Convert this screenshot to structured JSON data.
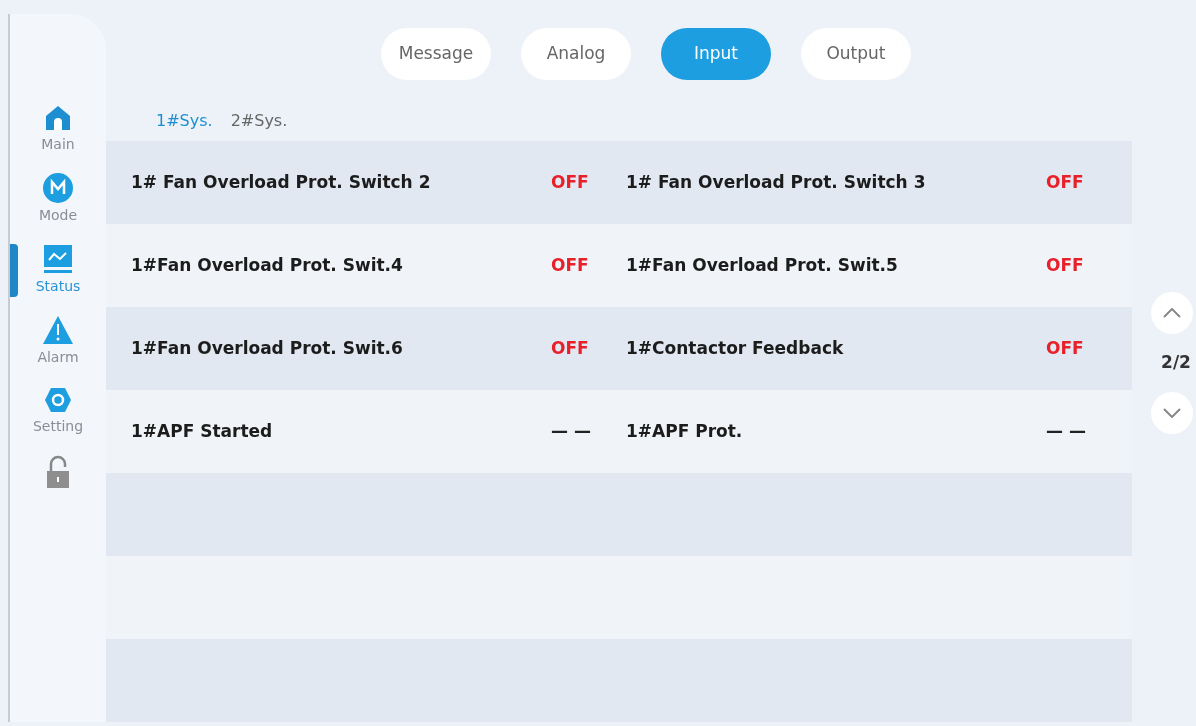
{
  "sidebar": {
    "items": [
      {
        "label": "Main",
        "selected": false
      },
      {
        "label": "Mode",
        "selected": false
      },
      {
        "label": "Status",
        "selected": true
      },
      {
        "label": "Alarm",
        "selected": false
      },
      {
        "label": "Setting",
        "selected": false
      },
      {
        "selected": false
      }
    ]
  },
  "tabs": [
    {
      "label": "Message",
      "selected": false
    },
    {
      "label": "Analog",
      "selected": false
    },
    {
      "label": "Input",
      "selected": true
    },
    {
      "label": "Output",
      "selected": false
    }
  ],
  "subtabs": [
    {
      "label": "1#Sys.",
      "selected": true
    },
    {
      "label": "2#Sys.",
      "selected": false
    }
  ],
  "rows": [
    [
      {
        "name": "1# Fan Overload Prot. Switch 2",
        "value": "OFF",
        "color": "#e8202a"
      },
      {
        "name": "1# Fan Overload Prot. Switch 3",
        "value": "OFF",
        "color": "#e8202a"
      }
    ],
    [
      {
        "name": "1#Fan Overload Prot. Swit.4",
        "value": "OFF",
        "color": "#e8202a"
      },
      {
        "name": "1#Fan Overload Prot. Swit.5",
        "value": "OFF",
        "color": "#e8202a"
      }
    ],
    [
      {
        "name": "1#Fan Overload Prot. Swit.6",
        "value": "OFF",
        "color": "#e8202a"
      },
      {
        "name": "1#Contactor Feedback",
        "value": "OFF",
        "color": "#e8202a"
      }
    ],
    [
      {
        "name": "1#APF Started",
        "value": "— —",
        "color": "#222222"
      },
      {
        "name": "1#APF Prot.",
        "value": "— —",
        "color": "#222222"
      }
    ]
  ],
  "pager": {
    "page": "2/2"
  }
}
